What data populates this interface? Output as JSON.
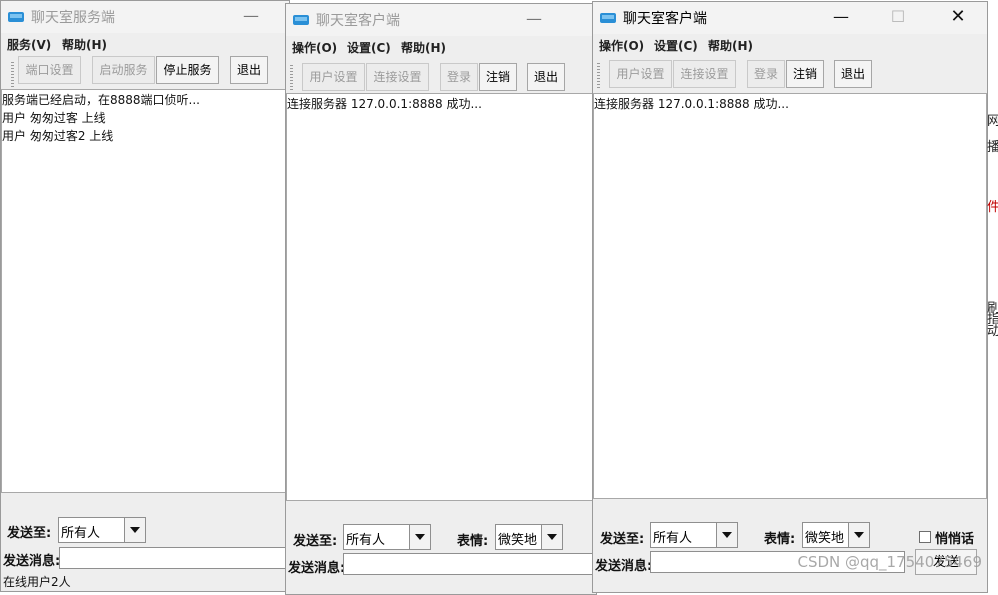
{
  "server": {
    "title": "聊天室服务端",
    "menus": [
      "服务(V)",
      "帮助(H)"
    ],
    "toolbar": [
      "端口设置",
      "启动服务",
      "停止服务",
      "退出"
    ],
    "log": [
      "服务端已经启动，在8888端口侦听...",
      "用户 匆匆过客 上线",
      "用户 匆匆过客2 上线"
    ],
    "send_to_label": "发送至:",
    "send_to_value": "所有人",
    "send_msg_label": "发送消息:",
    "status": "在线用户2人"
  },
  "client1": {
    "title": "聊天室客户端",
    "menus": [
      "操作(O)",
      "设置(C)",
      "帮助(H)"
    ],
    "toolbar": [
      "用户设置",
      "连接设置",
      "登录",
      "注销",
      "退出"
    ],
    "log": [
      "连接服务器 127.0.0.1:8888 成功..."
    ],
    "send_to_label": "发送至:",
    "send_to_value": "所有人",
    "emotion_label": "表情:",
    "emotion_value": "微笑地",
    "send_msg_label": "发送消息:"
  },
  "client2": {
    "title": "聊天室客户端",
    "menus": [
      "操作(O)",
      "设置(C)",
      "帮助(H)"
    ],
    "toolbar": [
      "用户设置",
      "连接设置",
      "登录",
      "注销",
      "退出"
    ],
    "log": [
      "连接服务器 127.0.0.1:8888 成功..."
    ],
    "send_to_label": "发送至:",
    "send_to_value": "所有人",
    "emotion_label": "表情:",
    "emotion_value": "微笑地",
    "whisper_label": "悄悄话",
    "send_msg_label": "发送消息:",
    "send_button": "发送"
  },
  "watermark": "CSDN @qq_1754075469",
  "edge_chars": [
    "网",
    "播",
    "件",
    "刷",
    "指",
    "动"
  ]
}
